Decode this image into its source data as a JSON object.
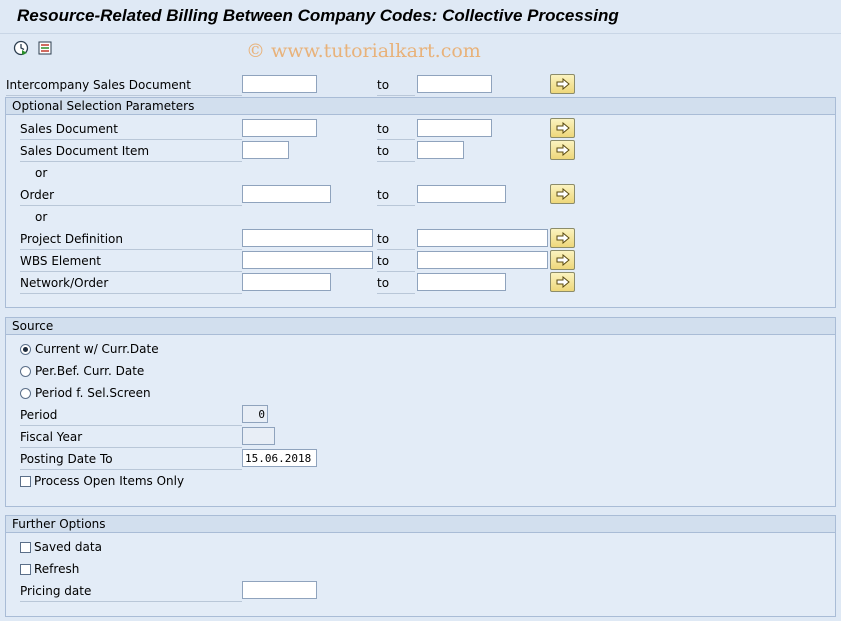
{
  "title": "Resource-Related Billing Between Company Codes: Collective Processing",
  "watermark": "© www.tutorialkart.com",
  "toolbar": {
    "execute_icon": "execute-clock-icon",
    "variant_icon": "selection-options-icon"
  },
  "to_label": "to",
  "or_label": "or",
  "main": {
    "intercompany_label": "Intercompany Sales Document",
    "intercompany_from": "",
    "intercompany_to": ""
  },
  "optional": {
    "header": "Optional Selection Parameters",
    "sales_document_label": "Sales Document",
    "sales_document_item_label": "Sales Document Item",
    "order_label": "Order",
    "project_definition_label": "Project Definition",
    "wbs_element_label": "WBS Element",
    "network_order_label": "Network/Order"
  },
  "source": {
    "header": "Source",
    "radio_current": "Current w/ Curr.Date",
    "radio_perbef": "Per.Bef. Curr. Date",
    "radio_period_sel": "Period f. Sel.Screen",
    "selected_radio": "Current w/ Curr.Date",
    "period_label": "Period",
    "period_value": "0",
    "fiscal_year_label": "Fiscal Year",
    "fiscal_year_value": "",
    "posting_date_label": "Posting Date To",
    "posting_date_value": "15.06.2018",
    "process_open_label": "Process Open Items Only",
    "process_open_checked": false
  },
  "further": {
    "header": "Further Options",
    "saved_data_label": "Saved data",
    "saved_data_checked": false,
    "refresh_label": "Refresh",
    "refresh_checked": false,
    "pricing_date_label": "Pricing date",
    "pricing_date_value": ""
  },
  "colors": {
    "background": "#dfe9f5",
    "group_header": "#d2dfee",
    "button_yellow": "#eed77a"
  }
}
